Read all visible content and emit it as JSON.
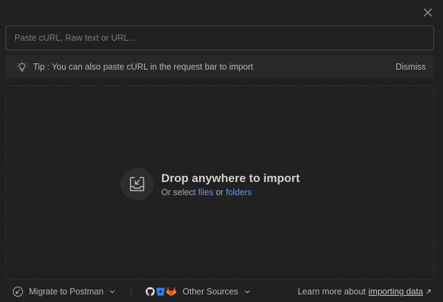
{
  "input": {
    "placeholder": "Paste cURL, Raw text or URL..."
  },
  "tip": {
    "text": "Tip : You can also paste cURL in the request bar to import",
    "dismiss_label": "Dismiss"
  },
  "drop": {
    "title": "Drop anywhere to import",
    "sub_prefix": "Or select",
    "files_label": "files",
    "or_label": "or",
    "folders_label": "folders"
  },
  "footer": {
    "migrate_label": "Migrate to Postman",
    "other_sources_label": "Other Sources",
    "learn_prefix": "Learn more about",
    "learn_link": "importing data"
  },
  "icons": {
    "close": "close-icon",
    "tip": "lightbulb-icon",
    "drop": "import-tray-icon",
    "migrate": "migrate-icon",
    "github": "github-icon",
    "bitbucket": "bitbucket-icon",
    "gitlab": "gitlab-icon",
    "external": "external-arrow-icon"
  },
  "colors": {
    "background": "#212121",
    "link": "#5b9af4",
    "bitbucket": "#2684ff",
    "gitlab": "#fc6d26"
  }
}
